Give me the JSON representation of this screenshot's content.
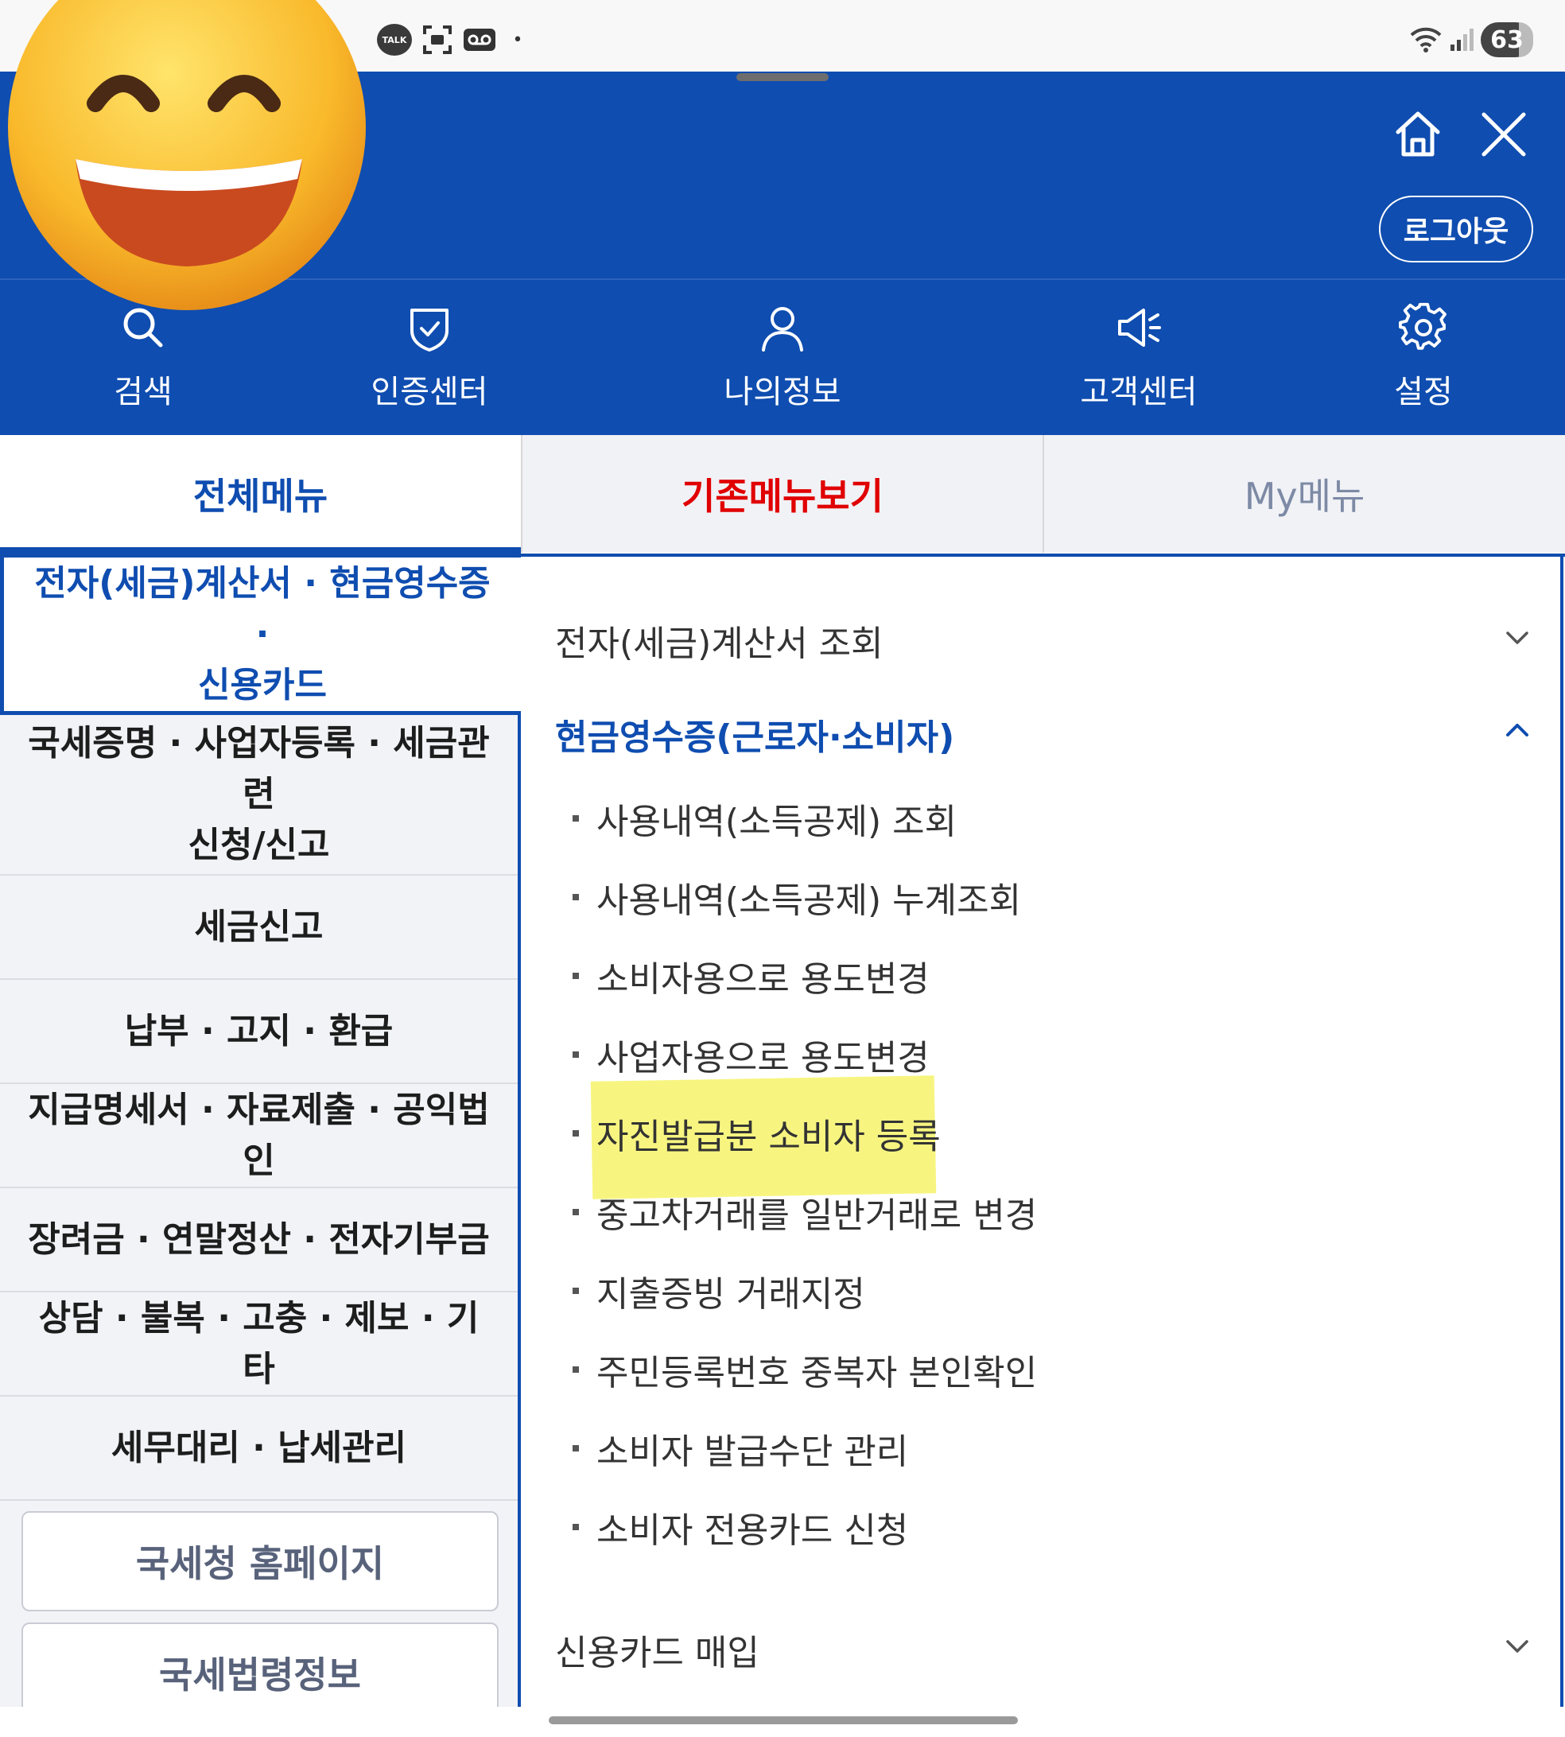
{
  "status_bar": {
    "talk_label": "TALK",
    "battery": "63"
  },
  "header": {
    "logout_label": "로그아웃",
    "quick_nav": [
      {
        "label": "검색",
        "icon": "search-icon"
      },
      {
        "label": "인증센터",
        "icon": "shield-check-icon"
      },
      {
        "label": "나의정보",
        "icon": "user-icon"
      },
      {
        "label": "고객센터",
        "icon": "megaphone-icon"
      },
      {
        "label": "설정",
        "icon": "gear-icon"
      }
    ]
  },
  "tabs": [
    {
      "label": "전체메뉴",
      "selected": true
    },
    {
      "label": "기존메뉴보기",
      "selected": false
    },
    {
      "label": "My메뉴",
      "selected": false
    }
  ],
  "left_menu": {
    "items": [
      {
        "line1": "전자(세금)계산서 · 현금영수증 ·",
        "line2": "신용카드",
        "active": true
      },
      {
        "line1": "국세증명 · 사업자등록 · 세금관련",
        "line2": "신청/신고",
        "active": false
      },
      {
        "line1": "세금신고",
        "active": false
      },
      {
        "line1": "납부 · 고지 · 환급",
        "active": false
      },
      {
        "line1": "지급명세서 · 자료제출 · 공익법인",
        "active": false
      },
      {
        "line1": "장려금 · 연말정산 · 전자기부금",
        "active": false
      },
      {
        "line1": "상담 · 불복 · 고충 · 제보 · 기타",
        "active": false
      },
      {
        "line1": "세무대리 · 납세관리",
        "active": false
      }
    ],
    "links": [
      {
        "label": "국세청 홈페이지"
      },
      {
        "label": "국세법령정보"
      }
    ]
  },
  "right_panel": {
    "sections": [
      {
        "title": "전자(세금)계산서 조회",
        "expanded": false
      },
      {
        "title": "현금영수증(근로자·소비자)",
        "expanded": true,
        "items": [
          "사용내역(소득공제) 조회",
          "사용내역(소득공제) 누계조회",
          "소비자용으로 용도변경",
          "사업자용으로 용도변경",
          "자진발급분 소비자 등록",
          "중고차거래를 일반거래로 변경",
          "지출증빙 거래지정",
          "주민등록번호 중복자 본인확인",
          "소비자 발급수단 관리",
          "소비자 전용카드 신청"
        ],
        "highlighted_item": "자진발급분 소비자 등록"
      },
      {
        "title": "신용카드 매입",
        "expanded": false
      }
    ]
  },
  "colors": {
    "brand_blue": "#0f4db0",
    "alert_red": "#e00000",
    "highlight_yellow": "#f6f36a"
  }
}
